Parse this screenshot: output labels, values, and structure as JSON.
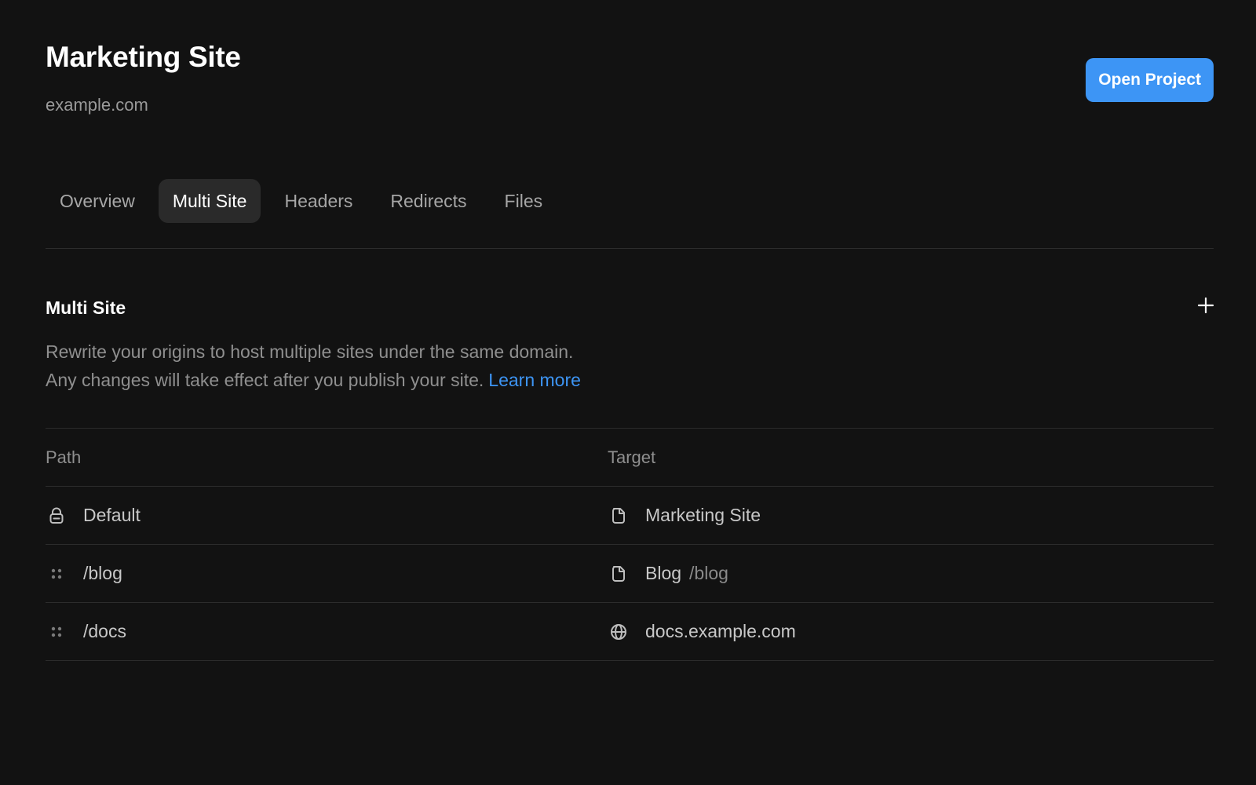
{
  "header": {
    "title": "Marketing Site",
    "domain": "example.com",
    "open_project_label": "Open Project"
  },
  "tabs": [
    {
      "label": "Overview",
      "active": false
    },
    {
      "label": "Multi Site",
      "active": true
    },
    {
      "label": "Headers",
      "active": false
    },
    {
      "label": "Redirects",
      "active": false
    },
    {
      "label": "Files",
      "active": false
    }
  ],
  "section": {
    "title": "Multi Site",
    "add_icon": "plus-icon",
    "description_line1": "Rewrite your origins to host multiple sites under the same domain.",
    "description_line2": "Any changes will take effect after you publish your site.",
    "learn_more": "Learn more"
  },
  "table": {
    "headers": {
      "path": "Path",
      "target": "Target"
    },
    "rows": [
      {
        "path_icon": "lock-icon",
        "path": "Default",
        "target_icon": "page-icon",
        "target": "Marketing Site",
        "target_sub": ""
      },
      {
        "path_icon": "drag-handle-icon",
        "path": "/blog",
        "target_icon": "page-icon",
        "target": "Blog",
        "target_sub": "/blog"
      },
      {
        "path_icon": "drag-handle-icon",
        "path": "/docs",
        "target_icon": "globe-icon",
        "target": "docs.example.com",
        "target_sub": ""
      }
    ]
  },
  "colors": {
    "background": "#121212",
    "accent": "#3d95f5",
    "active_tab": "#2a2a2a",
    "divider": "#2c2c2c"
  }
}
